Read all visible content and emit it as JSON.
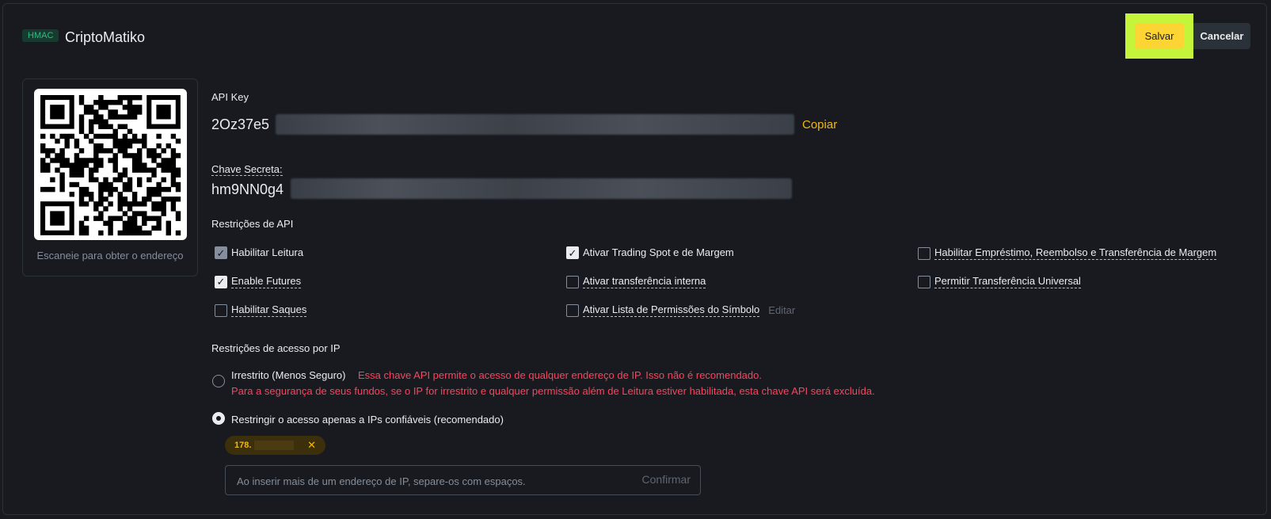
{
  "header": {
    "tag": "HMAC",
    "title": "CriptoMatiko",
    "save_label": "Salvar",
    "cancel_label": "Cancelar"
  },
  "qr": {
    "caption": "Escaneie para obter o endereço"
  },
  "api_key": {
    "label": "API Key",
    "value_prefix": "2Oz37e5",
    "copy_label": "Copiar"
  },
  "secret": {
    "label": "Chave Secreta:",
    "value_prefix": "hm9NN0g4"
  },
  "restrictions": {
    "title": "Restrições de API",
    "permissions": [
      {
        "label": "Habilitar Leitura",
        "checked": true,
        "disabled": true
      },
      {
        "label": "Ativar Trading Spot e de Margem",
        "checked": true
      },
      {
        "label": "Habilitar Empréstimo, Reembolso e Transferência de Margem",
        "checked": false
      },
      {
        "label": "Enable Futures",
        "checked": true
      },
      {
        "label": "Ativar transferência interna",
        "checked": false
      },
      {
        "label": "Permitir Transferência Universal",
        "checked": false
      },
      {
        "label": "Habilitar Saques",
        "checked": false
      },
      {
        "label": "Ativar Lista de Permissões do Símbolo",
        "checked": false
      }
    ],
    "edit_label": "Editar"
  },
  "ip_access": {
    "title": "Restrições de acesso por IP",
    "unrestricted_label": "Irrestrito (Menos Seguro)",
    "unrestricted_warning_1": "Essa chave API permite o acesso de qualquer endereço de IP. Isso não é recomendado.",
    "unrestricted_warning_2": "Para a segurança de seus fundos, se o IP for irrestrito e qualquer permissão além de Leitura estiver habilitada, esta chave API será excluída.",
    "restricted_label": "Restringir o acesso apenas a IPs confiáveis (recomendado)",
    "selected": "restricted",
    "ip_chip": "178.",
    "input_placeholder": "Ao inserir mais de um endereço de IP, separe-os com espaços.",
    "confirm_label": "Confirmar"
  },
  "icons": {
    "close": "close-icon",
    "check": "check-icon"
  }
}
